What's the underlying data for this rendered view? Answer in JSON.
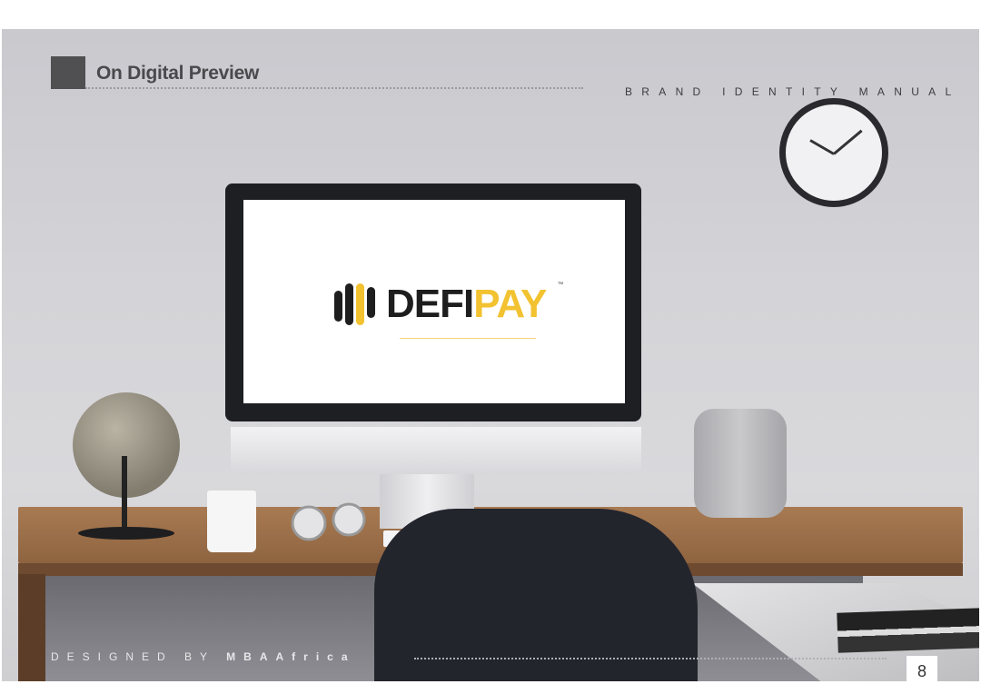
{
  "header": {
    "title": "On Digital Preview",
    "subtitle": "BRAND IDENTITY MANUAL"
  },
  "screen_logo": {
    "brand_dark": "DEFI",
    "brand_accent": "PAY",
    "trademark": "™",
    "colors": {
      "dark": "#1e1e1e",
      "accent": "#f2c230"
    }
  },
  "footer": {
    "designed_by": "DESIGNED BY",
    "designer": "MBAAfrica",
    "page_number": "8"
  }
}
